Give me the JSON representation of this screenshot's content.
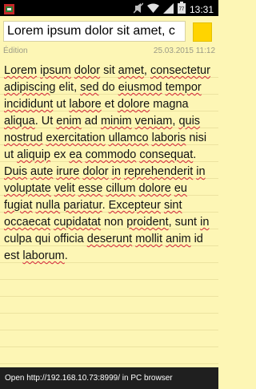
{
  "status_bar": {
    "time": "13:31",
    "battery_level": "77",
    "icons": [
      "app-notification-icon",
      "mute-icon",
      "wifi-icon",
      "signal-icon",
      "battery-icon"
    ]
  },
  "header": {
    "title_value": "Lorem ipsum dolor sit amet, c",
    "swatch_color": "#ffd400"
  },
  "meta": {
    "mode": "Édition",
    "date": "25.03.2015 11:12"
  },
  "note": {
    "body": "Lorem ipsum dolor sit amet, consectetur adipiscing elit, sed do eiusmod tempor incididunt ut labore et dolore magna aliqua. Ut enim ad minim veniam, quis nostrud exercitation ullamco laboris nisi ut aliquip ex ea commodo consequat. Duis aute irure dolor in reprehenderit in voluptate velit esse cillum dolore eu fugiat nulla pariatur. Excepteur sint occaecat cupidatat non proident, sunt in culpa qui officia deserunt mollit anim id est laborum."
  },
  "bottom_bar": {
    "message": "Open http://192.168.10.73:8999/ in PC browser"
  },
  "colors": {
    "background": "#fdf6b5",
    "spellcheck": "#d7263d"
  }
}
